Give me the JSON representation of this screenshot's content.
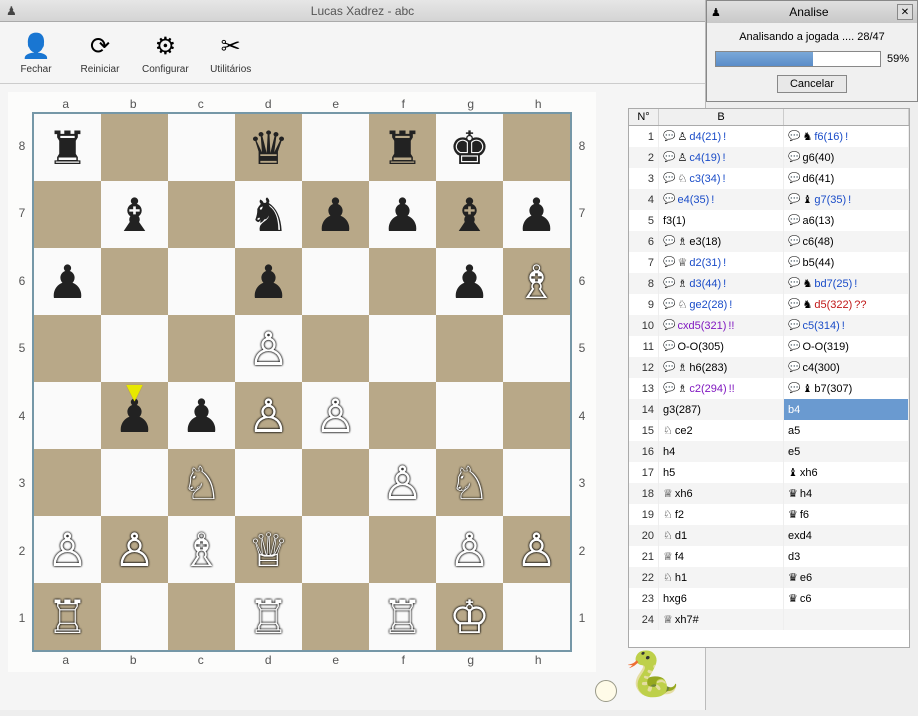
{
  "main_title": "Lucas Xadrez - abc",
  "dialog": {
    "title": "Analise",
    "status": "Analisando a jogada .... 28/47",
    "progress_pct": 59,
    "cancel": "Cancelar"
  },
  "toolbar": [
    {
      "name": "fechar",
      "label": "Fechar",
      "icon": "👤"
    },
    {
      "name": "reiniciar",
      "label": "Reiniciar",
      "icon": "⟳"
    },
    {
      "name": "configurar",
      "label": "Configurar",
      "icon": "⚙"
    },
    {
      "name": "utilitarios",
      "label": "Utilitários",
      "icon": "✂"
    }
  ],
  "files": [
    "a",
    "b",
    "c",
    "d",
    "e",
    "f",
    "g",
    "h"
  ],
  "ranks": [
    "8",
    "7",
    "6",
    "5",
    "4",
    "3",
    "2",
    "1"
  ],
  "chart_data": {
    "type": "table",
    "description": "Chess position (FEN-like square listing, white to move, arrow at b4)",
    "arrow_square": "b4",
    "squares": {
      "a8": "br",
      "d8": "bq",
      "f8": "br",
      "g8": "bk",
      "b7": "bb",
      "d7": "bn",
      "e7": "bp",
      "f7": "bp",
      "g7": "bb",
      "h7": "bp",
      "a6": "bp",
      "d6": "bp",
      "g6": "bp",
      "h6": "wb",
      "d5": "wp",
      "b4": "bp",
      "c4": "bp",
      "d4": "wp",
      "e4": "wp",
      "c3": "wn",
      "f3": "wp",
      "g3": "wn",
      "a2": "wp",
      "b2": "wp",
      "c2": "wb",
      "d2": "wq",
      "g2": "wp",
      "h2": "wp",
      "a1": "wr",
      "d1": "wr",
      "f1": "wr",
      "g1": "wk"
    }
  },
  "moves_header": {
    "num": "N°",
    "white": "B",
    "black": ""
  },
  "moves": [
    {
      "n": 1,
      "w": {
        "p": "♙",
        "t": "d4(21)",
        "m": "!",
        "c": "c-blue",
        "s": 1
      },
      "b": {
        "p": "♞",
        "t": "f6(16)",
        "m": "!",
        "c": "c-blue",
        "s": 1
      }
    },
    {
      "n": 2,
      "w": {
        "p": "♙",
        "t": "c4(19)",
        "m": "!",
        "c": "c-blue",
        "s": 1
      },
      "b": {
        "p": "",
        "t": "g6(40)",
        "m": "",
        "c": "",
        "s": 1
      }
    },
    {
      "n": 3,
      "w": {
        "p": "♘",
        "t": "c3(34)",
        "m": "!",
        "c": "c-blue",
        "s": 1
      },
      "b": {
        "p": "",
        "t": "d6(41)",
        "m": "",
        "c": "",
        "s": 1
      }
    },
    {
      "n": 4,
      "w": {
        "p": "",
        "t": "e4(35)",
        "m": "!",
        "c": "c-blue",
        "s": 1
      },
      "b": {
        "p": "♝",
        "t": "g7(35)",
        "m": "!",
        "c": "c-blue",
        "s": 1
      }
    },
    {
      "n": 5,
      "w": {
        "p": "",
        "t": "f3(1)",
        "m": "",
        "c": "",
        "s": 0
      },
      "b": {
        "p": "",
        "t": "a6(13)",
        "m": "",
        "c": "",
        "s": 1
      }
    },
    {
      "n": 6,
      "w": {
        "p": "♗",
        "t": "e3(18)",
        "m": "",
        "c": "",
        "s": 1
      },
      "b": {
        "p": "",
        "t": "c6(48)",
        "m": "",
        "c": "",
        "s": 1
      }
    },
    {
      "n": 7,
      "w": {
        "p": "♕",
        "t": "d2(31)",
        "m": "!",
        "c": "c-blue",
        "s": 1
      },
      "b": {
        "p": "",
        "t": "b5(44)",
        "m": "",
        "c": "",
        "s": 1
      }
    },
    {
      "n": 8,
      "w": {
        "p": "♗",
        "t": "d3(44)",
        "m": "!",
        "c": "c-blue",
        "s": 1
      },
      "b": {
        "p": "♞",
        "t": "bd7(25)",
        "m": "!",
        "c": "c-blue",
        "s": 1
      }
    },
    {
      "n": 9,
      "w": {
        "p": "♘",
        "t": "ge2(28)",
        "m": "!",
        "c": "c-blue",
        "s": 1
      },
      "b": {
        "p": "♞",
        "t": "d5(322)",
        "m": "??",
        "c": "c-red",
        "s": 1
      }
    },
    {
      "n": 10,
      "w": {
        "p": "",
        "t": "cxd5(321)",
        "m": "!!",
        "c": "c-pur",
        "s": 1
      },
      "b": {
        "p": "",
        "t": "c5(314)",
        "m": "!",
        "c": "c-blue",
        "s": 1
      }
    },
    {
      "n": 11,
      "w": {
        "p": "",
        "t": "O-O(305)",
        "m": "",
        "c": "",
        "s": 1
      },
      "b": {
        "p": "",
        "t": "O-O(319)",
        "m": "",
        "c": "",
        "s": 1
      }
    },
    {
      "n": 12,
      "w": {
        "p": "♗",
        "t": "h6(283)",
        "m": "",
        "c": "",
        "s": 1
      },
      "b": {
        "p": "",
        "t": "c4(300)",
        "m": "",
        "c": "",
        "s": 1
      }
    },
    {
      "n": 13,
      "w": {
        "p": "♗",
        "t": "c2(294)",
        "m": "!!",
        "c": "c-pur",
        "s": 1
      },
      "b": {
        "p": "♝",
        "t": "b7(307)",
        "m": "",
        "c": "",
        "s": 1
      }
    },
    {
      "n": 14,
      "w": {
        "p": "",
        "t": "g3(287)",
        "m": "",
        "c": "",
        "s": 0
      },
      "b": {
        "p": "",
        "t": "b4",
        "m": "",
        "c": "",
        "s": 0
      },
      "sel": 1
    },
    {
      "n": 15,
      "w": {
        "p": "♘",
        "t": "ce2",
        "m": "",
        "c": "",
        "s": 0
      },
      "b": {
        "p": "",
        "t": "a5",
        "m": "",
        "c": "",
        "s": 0
      }
    },
    {
      "n": 16,
      "w": {
        "p": "",
        "t": "h4",
        "m": "",
        "c": "",
        "s": 0
      },
      "b": {
        "p": "",
        "t": "e5",
        "m": "",
        "c": "",
        "s": 0
      }
    },
    {
      "n": 17,
      "w": {
        "p": "",
        "t": "h5",
        "m": "",
        "c": "",
        "s": 0
      },
      "b": {
        "p": "♝",
        "t": "xh6",
        "m": "",
        "c": "",
        "s": 0
      }
    },
    {
      "n": 18,
      "w": {
        "p": "♕",
        "t": "xh6",
        "m": "",
        "c": "",
        "s": 0
      },
      "b": {
        "p": "♛",
        "t": "h4",
        "m": "",
        "c": "",
        "s": 0
      }
    },
    {
      "n": 19,
      "w": {
        "p": "♘",
        "t": "f2",
        "m": "",
        "c": "",
        "s": 0
      },
      "b": {
        "p": "♛",
        "t": "f6",
        "m": "",
        "c": "",
        "s": 0
      }
    },
    {
      "n": 20,
      "w": {
        "p": "♘",
        "t": "d1",
        "m": "",
        "c": "",
        "s": 0
      },
      "b": {
        "p": "",
        "t": "exd4",
        "m": "",
        "c": "",
        "s": 0
      }
    },
    {
      "n": 21,
      "w": {
        "p": "♕",
        "t": "f4",
        "m": "",
        "c": "",
        "s": 0
      },
      "b": {
        "p": "",
        "t": "d3",
        "m": "",
        "c": "",
        "s": 0
      }
    },
    {
      "n": 22,
      "w": {
        "p": "♘",
        "t": "h1",
        "m": "",
        "c": "",
        "s": 0
      },
      "b": {
        "p": "♛",
        "t": "e6",
        "m": "",
        "c": "",
        "s": 0
      }
    },
    {
      "n": 23,
      "w": {
        "p": "",
        "t": "hxg6",
        "m": "",
        "c": "",
        "s": 0
      },
      "b": {
        "p": "♛",
        "t": "c6",
        "m": "",
        "c": "",
        "s": 0
      }
    },
    {
      "n": 24,
      "w": {
        "p": "♕",
        "t": "xh7#",
        "m": "",
        "c": "",
        "s": 0
      },
      "b": {
        "p": "",
        "t": "",
        "m": "",
        "c": "",
        "s": 0
      }
    }
  ],
  "piece_glyphs": {
    "wk": "♔",
    "wq": "♕",
    "wr": "♖",
    "wb": "♗",
    "wn": "♘",
    "wp": "♙",
    "bk": "♚",
    "bq": "♛",
    "br": "♜",
    "bb": "♝",
    "bn": "♞",
    "bp": "♟"
  }
}
